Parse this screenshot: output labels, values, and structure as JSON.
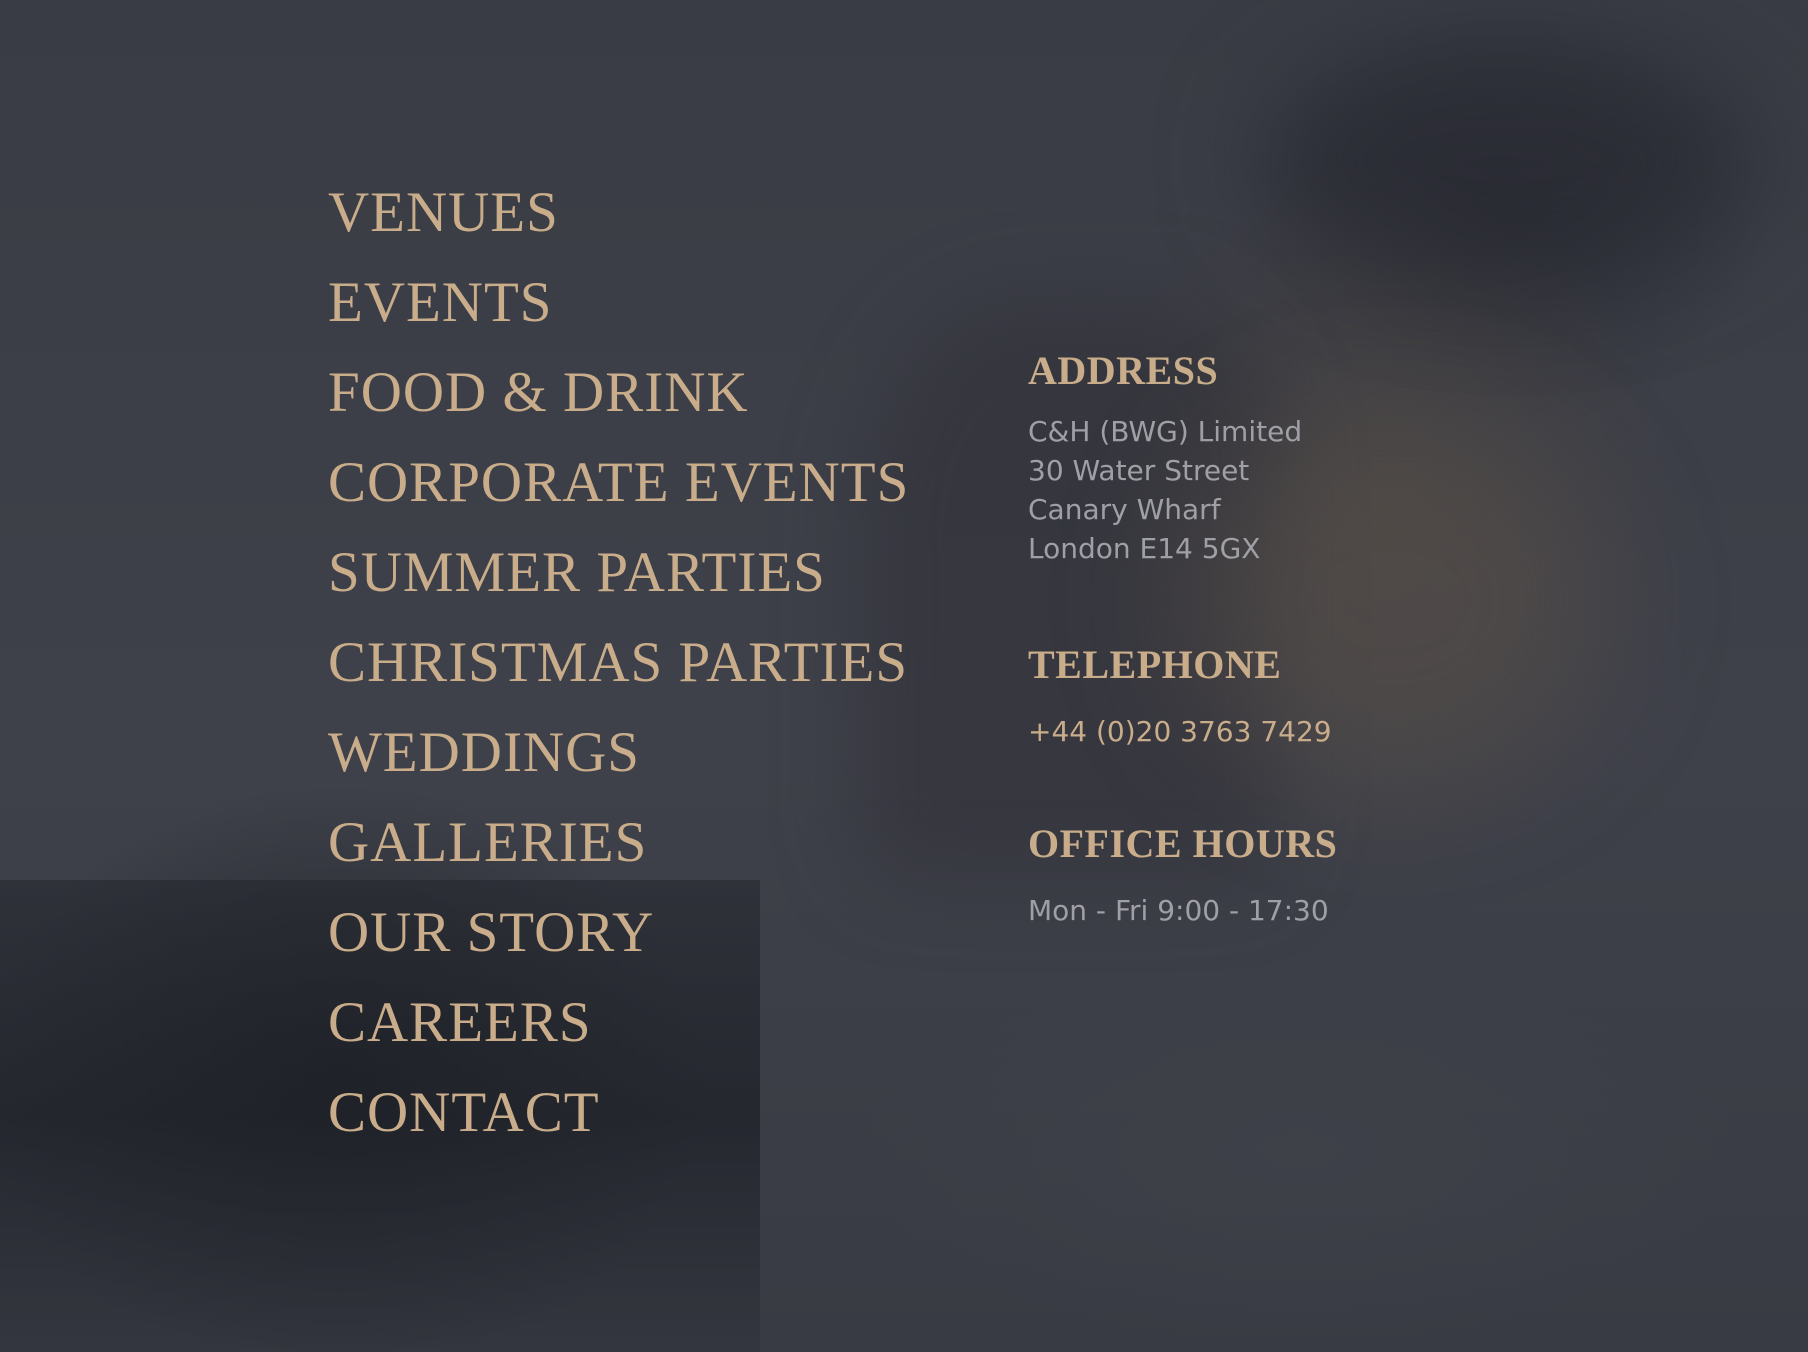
{
  "colors": {
    "background": "#3c3e47",
    "accent_gold": "#c9ad8b",
    "muted_text": "#9fa0a6"
  },
  "nav": {
    "items": [
      {
        "label": "VENUES"
      },
      {
        "label": "EVENTS"
      },
      {
        "label": "FOOD & DRINK"
      },
      {
        "label": "CORPORATE EVENTS"
      },
      {
        "label": "SUMMER PARTIES"
      },
      {
        "label": "CHRISTMAS PARTIES"
      },
      {
        "label": "WEDDINGS"
      },
      {
        "label": "GALLERIES"
      },
      {
        "label": "OUR STORY"
      },
      {
        "label": "CAREERS"
      },
      {
        "label": "CONTACT"
      }
    ]
  },
  "contact": {
    "address_heading": "ADDRESS",
    "address_lines": [
      "C&H (BWG) Limited",
      "30 Water Street",
      "Canary Wharf",
      "London E14 5GX"
    ],
    "telephone_heading": "TELEPHONE",
    "telephone": "+44 (0)20 3763 7429",
    "hours_heading": "OFFICE HOURS",
    "hours": "Mon - Fri 9:00 - 17:30"
  }
}
